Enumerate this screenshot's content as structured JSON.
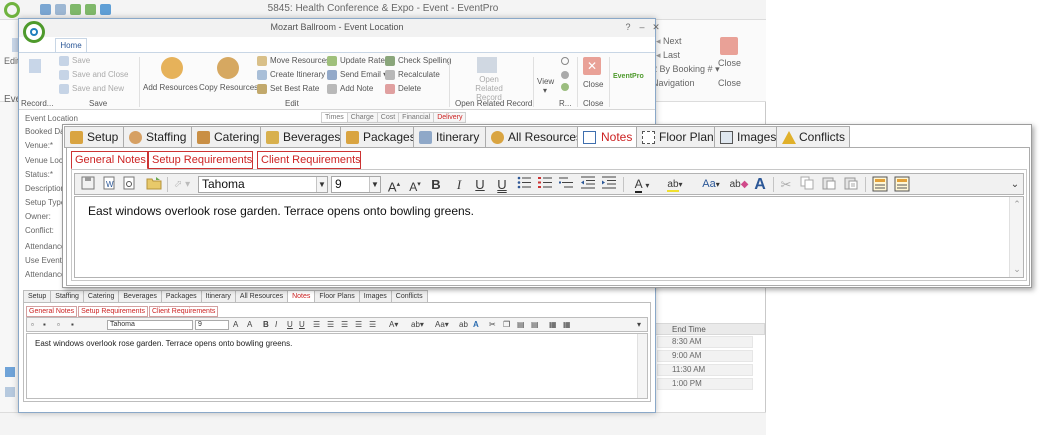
{
  "back_window": {
    "title": "5845: Health Conference & Expo - Event - EventPro",
    "sidebar_labels": [
      "Edit",
      "Eve",
      "Record"
    ],
    "nav": {
      "next": "Next",
      "last": "Last",
      "by_booking": "By Booking #",
      "navigation": "Navigation",
      "close": "Close",
      "close_group": "Close"
    },
    "grid": {
      "header": "End Time",
      "times": [
        "8:30 AM",
        "9:00 AM",
        "11:30 AM",
        "1:00 PM"
      ]
    }
  },
  "mid_window": {
    "title": "Mozart Ballroom - Event Location",
    "ribbon_tab": "Home",
    "ribbon": {
      "save": "Save",
      "save_close": "Save and Close",
      "save_new": "Save and New",
      "save_group": "Save",
      "record": "Record...",
      "add_resources": "Add Resources",
      "copy_resources": "Copy Resources",
      "move_resources": "Move Resources",
      "create_itinerary": "Create Itinerary",
      "set_best_rate": "Set Best Rate",
      "update_rate": "Update Rate",
      "send_email": "Send Email",
      "add_note": "Add Note",
      "check_spelling": "Check Spelling",
      "recalculate": "Recalculate",
      "delete": "Delete",
      "edit_group": "Edit",
      "open_related_record": "Open Related Record",
      "open_related_group": "Open Related Record",
      "view": "View",
      "r_group": "R...",
      "close": "Close",
      "close_group": "Close",
      "brand": "EventPro"
    },
    "form_labels": [
      "Event Location",
      "Booked Dat",
      "Venue:*",
      "Venue Locat",
      "Status:*",
      "Description",
      "Setup Type",
      "Owner:",
      "Conflict:",
      "Attendance",
      "Use Event A",
      "Attendance"
    ],
    "subtabs": [
      "Times",
      "Charge",
      "Cost",
      "Financial",
      "Delivery"
    ],
    "small_tabs": [
      "Setup",
      "Staffing",
      "Catering",
      "Beverages",
      "Packages",
      "Itinerary",
      "All Resources",
      "Notes",
      "Floor Plans",
      "Images",
      "Conflicts"
    ],
    "small_note_tabs": [
      "General Notes",
      "Setup Requirements",
      "Client Requirements"
    ],
    "small_font": "Tahoma",
    "small_size": "9",
    "small_note_text": "East windows overlook rose garden. Terrace opens onto bowling greens."
  },
  "front": {
    "tabs": [
      {
        "label": "Setup",
        "icon": "setup-icon"
      },
      {
        "label": "Staffing",
        "icon": "staffing-icon"
      },
      {
        "label": "Catering",
        "icon": "catering-icon"
      },
      {
        "label": "Beverages",
        "icon": "beverages-icon"
      },
      {
        "label": "Packages",
        "icon": "packages-icon"
      },
      {
        "label": "Itinerary",
        "icon": "itinerary-icon"
      },
      {
        "label": "All Resources",
        "icon": "all-resources-icon"
      },
      {
        "label": "Notes",
        "icon": "notes-icon"
      },
      {
        "label": "Floor Plans",
        "icon": "floor-plans-icon"
      },
      {
        "label": "Images",
        "icon": "images-icon"
      },
      {
        "label": "Conflicts",
        "icon": "conflicts-icon"
      }
    ],
    "active_tab": "Notes",
    "note_tabs": [
      "General Notes",
      "Setup Requirements",
      "Client Requirements"
    ],
    "active_note_tab": "General Notes",
    "toolbar": {
      "font": "Tahoma",
      "size": "9"
    },
    "note_text": "East windows overlook rose garden. Terrace opens onto bowling greens."
  },
  "colors": {
    "accent_red": "#cc2222",
    "brand_green": "#6fb33e",
    "brand_blue": "#1f7fbd",
    "ribbon_blue": "#2b5797"
  }
}
